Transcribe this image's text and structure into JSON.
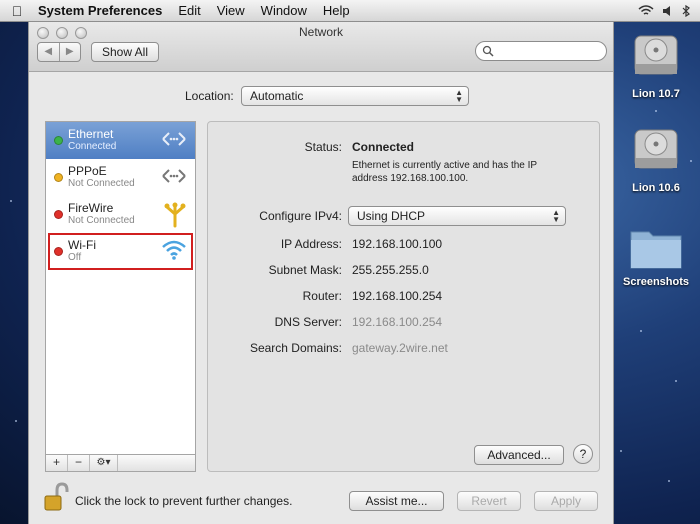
{
  "menubar": {
    "app": "System Preferences",
    "items": [
      "Edit",
      "View",
      "Window",
      "Help"
    ]
  },
  "window": {
    "title": "Network",
    "show_all": "Show All",
    "location_label": "Location:",
    "location_value": "Automatic"
  },
  "services": [
    {
      "name": "Ethernet",
      "status": "Connected",
      "dot": "#3bb34a",
      "icon": "ethernet-arrows-icon"
    },
    {
      "name": "PPPoE",
      "status": "Not Connected",
      "dot": "#f0b323",
      "icon": "ethernet-arrows-icon"
    },
    {
      "name": "FireWire",
      "status": "Not Connected",
      "dot": "#e0302a",
      "icon": "firewire-icon"
    },
    {
      "name": "Wi-Fi",
      "status": "Off",
      "dot": "#e0302a",
      "icon": "wifi-icon"
    }
  ],
  "sidebar_tools": {
    "add": "+",
    "remove": "−",
    "gear": "⚙▾"
  },
  "details": {
    "status_label": "Status:",
    "status_value": "Connected",
    "status_desc": "Ethernet is currently active and has the IP address 192.168.100.100.",
    "configure_label": "Configure IPv4:",
    "configure_value": "Using DHCP",
    "ip_label": "IP Address:",
    "ip_value": "192.168.100.100",
    "subnet_label": "Subnet Mask:",
    "subnet_value": "255.255.255.0",
    "router_label": "Router:",
    "router_value": "192.168.100.254",
    "dns_label": "DNS Server:",
    "dns_value": "192.168.100.254",
    "search_label": "Search Domains:",
    "search_value": "gateway.2wire.net",
    "advanced": "Advanced...",
    "help": "?"
  },
  "footer": {
    "lock_text": "Click the lock to prevent further changes.",
    "assist": "Assist me...",
    "revert": "Revert",
    "apply": "Apply"
  },
  "desktop": [
    {
      "label": "Lion 10.7",
      "icon": "hard-drive-icon"
    },
    {
      "label": "Lion 10.6",
      "icon": "hard-drive-icon"
    },
    {
      "label": "Screenshots",
      "icon": "folder-icon"
    }
  ],
  "colors": {
    "selection": "#5b89c9",
    "highlight_box": "#d11f1f"
  }
}
